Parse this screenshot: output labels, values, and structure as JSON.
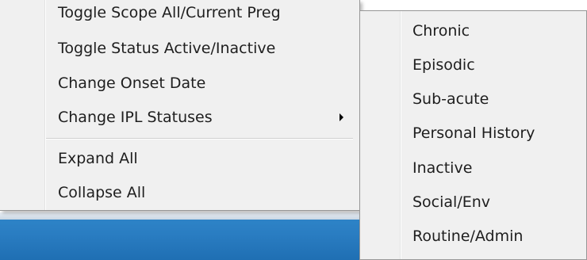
{
  "main_menu": {
    "items": [
      {
        "label": "Toggle Scope All/Current Preg"
      },
      {
        "label": "Toggle Status Active/Inactive"
      },
      {
        "label": "Change Onset Date"
      },
      {
        "label": "Change IPL Statuses",
        "has_submenu": true
      },
      {
        "label": "Expand All"
      },
      {
        "label": "Collapse All"
      }
    ]
  },
  "submenu": {
    "items": [
      {
        "label": "Chronic"
      },
      {
        "label": "Episodic"
      },
      {
        "label": "Sub-acute"
      },
      {
        "label": "Personal History"
      },
      {
        "label": "Inactive"
      },
      {
        "label": "Social/Env"
      },
      {
        "label": "Routine/Admin"
      }
    ]
  },
  "colors": {
    "menu_background": "#f0f0f0",
    "menu_border": "#979797",
    "text": "#1e1e1e",
    "desktop_blue": "#2a7dc2"
  }
}
